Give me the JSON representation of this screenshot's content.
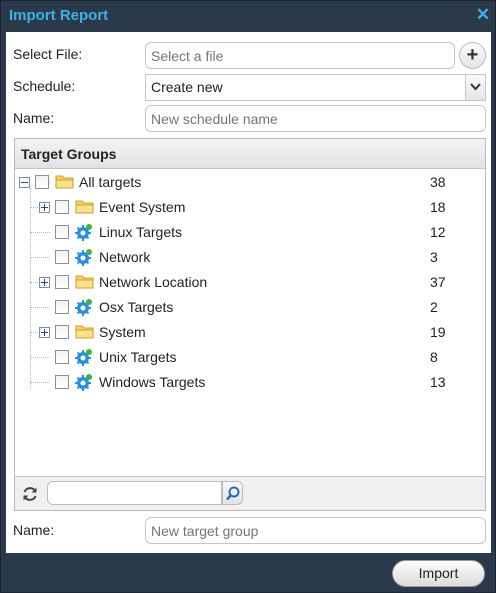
{
  "dialog": {
    "title": "Import Report",
    "close_glyph": "✕"
  },
  "form": {
    "select_file_label": "Select File:",
    "select_file_placeholder": "Select a file",
    "add_glyph": "+",
    "schedule_label": "Schedule:",
    "schedule_value": "Create new",
    "name_label": "Name:",
    "name_placeholder": "New schedule name"
  },
  "target_groups": {
    "title": "Target Groups",
    "items": [
      {
        "label": "All targets",
        "count": "38",
        "type": "folder",
        "expander": "minus"
      },
      {
        "label": "Event System",
        "count": "18",
        "type": "folder",
        "expander": "plus"
      },
      {
        "label": "Linux Targets",
        "count": "12",
        "type": "target",
        "expander": "none"
      },
      {
        "label": "Network",
        "count": "3",
        "type": "target",
        "expander": "none"
      },
      {
        "label": "Network Location",
        "count": "37",
        "type": "folder",
        "expander": "plus"
      },
      {
        "label": "Osx Targets",
        "count": "2",
        "type": "target",
        "expander": "none"
      },
      {
        "label": "System",
        "count": "19",
        "type": "folder",
        "expander": "plus"
      },
      {
        "label": "Unix Targets",
        "count": "8",
        "type": "target",
        "expander": "none"
      },
      {
        "label": "Windows Targets",
        "count": "13",
        "type": "target",
        "expander": "none"
      }
    ],
    "search_value": ""
  },
  "group_name": {
    "label": "Name:",
    "placeholder": "New target group"
  },
  "actions": {
    "import_label": "Import"
  },
  "colors": {
    "title_accent": "#3fb1e8",
    "chrome": "#2b3a4a",
    "folder": "#f4c842",
    "gear": "#2a8fd8"
  }
}
